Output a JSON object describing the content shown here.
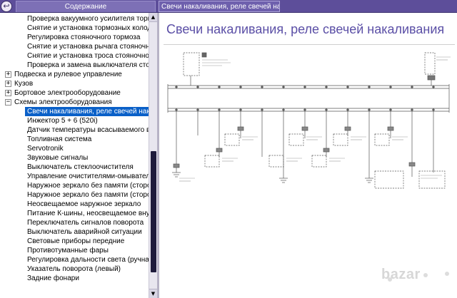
{
  "header": {
    "toc_tab_label": "Содержание",
    "doc_tab_title": "Свечи накаливания, реле свечей накаливания",
    "back_icon": "back-arrow-icon"
  },
  "tree": {
    "rows": [
      {
        "label": "Проверка вакуумного усилителя тормоз",
        "level": 2
      },
      {
        "label": "Снятие и установка тормозных колодо",
        "level": 2
      },
      {
        "label": "Регулировка стояночного тормоза",
        "level": 2
      },
      {
        "label": "Снятие и установка рычага стояночног",
        "level": 2
      },
      {
        "label": "Снятие и установка троса стояночног",
        "level": 2
      },
      {
        "label": "Проверка и замена выключателя стоя",
        "level": 2
      },
      {
        "label": "Подвеска и рулевое управление",
        "level": 1,
        "toggle": "+"
      },
      {
        "label": "Кузов",
        "level": 1,
        "toggle": "+"
      },
      {
        "label": "Бортовое электрооборудование",
        "level": 1,
        "toggle": "+"
      },
      {
        "label": "Схемы электрооборудования",
        "level": 1,
        "toggle": "−"
      },
      {
        "label": "Свечи накаливания, реле свечей нака",
        "level": 2,
        "selected": true
      },
      {
        "label": "Инжектор 5 + 6 (520i)",
        "level": 2
      },
      {
        "label": "Датчик температуры всасываемого в",
        "level": 2
      },
      {
        "label": "Топливная система",
        "level": 2
      },
      {
        "label": "Servotronik",
        "level": 2
      },
      {
        "label": "Звуковые сигналы",
        "level": 2
      },
      {
        "label": "Выключатель стеклоочистителя",
        "level": 2
      },
      {
        "label": "Управление очистителями-омывателя",
        "level": 2
      },
      {
        "label": "Наружное зеркало без памяти (сторон",
        "level": 2
      },
      {
        "label": "Наружное зеркало без памяти (сторон",
        "level": 2
      },
      {
        "label": "Неосвещаемое наружное зеркало",
        "level": 2
      },
      {
        "label": "Питание К-шины, неосвещаемое внут",
        "level": 2
      },
      {
        "label": "Переключатель сигналов поворота",
        "level": 2
      },
      {
        "label": "Выключатель аварийной ситуации",
        "level": 2
      },
      {
        "label": "Световые приборы передние",
        "level": 2
      },
      {
        "label": "Противотуманные фары",
        "level": 2
      },
      {
        "label": "Регулировка дальности света (ручная",
        "level": 2
      },
      {
        "label": "Указатель поворота (левый)",
        "level": 2
      },
      {
        "label": "Задние фонари",
        "level": 2
      }
    ]
  },
  "content": {
    "title": "Свечи накаливания, реле свечей накаливания"
  },
  "watermark": {
    "text": "bazar"
  },
  "colors": {
    "header_bg": "#5d4e9a",
    "selection": "#0a60c8",
    "title_color": "#5b4fa6",
    "scroll_thumb": "#1e1b3c"
  }
}
